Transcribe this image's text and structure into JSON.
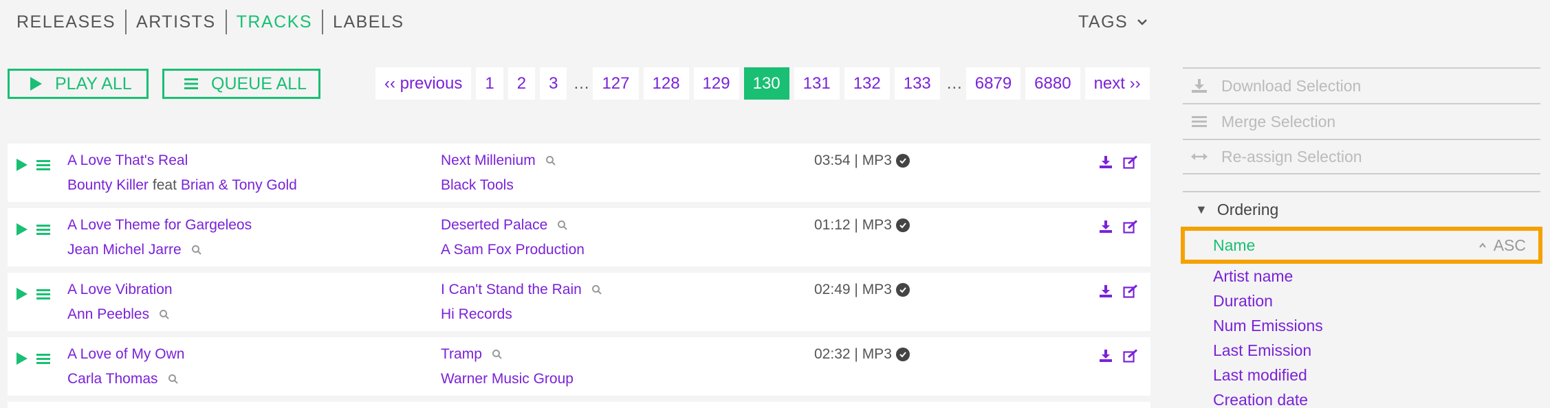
{
  "nav": {
    "items": [
      "RELEASES",
      "ARTISTS",
      "TRACKS",
      "LABELS"
    ],
    "active": "TRACKS",
    "tags_label": "TAGS"
  },
  "actions": {
    "play_all": "PLAY ALL",
    "queue_all": "QUEUE ALL"
  },
  "pagination": {
    "previous": "‹‹ previous",
    "next": "next ››",
    "pages": [
      "1",
      "2",
      "3",
      "…",
      "127",
      "128",
      "129",
      "130",
      "131",
      "132",
      "133",
      "…",
      "6879",
      "6880"
    ],
    "current": "130"
  },
  "tracks": [
    {
      "title": "A Love That's Real",
      "artist": "Bounty Killer",
      "feat_word": "feat",
      "feat_artist": "Brian & Tony Gold",
      "release": "Next Millenium",
      "label": "Black Tools",
      "duration": "03:54",
      "format": "MP3"
    },
    {
      "title": "A Love Theme for Gargeleos",
      "artist": "Jean Michel Jarre",
      "feat_word": "",
      "feat_artist": "",
      "release": "Deserted Palace",
      "label": "A Sam Fox Production",
      "duration": "01:12",
      "format": "MP3"
    },
    {
      "title": "A Love Vibration",
      "artist": "Ann Peebles",
      "feat_word": "",
      "feat_artist": "",
      "release": "I Can't Stand the Rain",
      "label": "Hi Records",
      "duration": "02:49",
      "format": "MP3"
    },
    {
      "title": "A Love of My Own",
      "artist": "Carla Thomas",
      "feat_word": "",
      "feat_artist": "",
      "release": "Tramp",
      "label": "Warner Music Group",
      "duration": "02:32",
      "format": "MP3"
    }
  ],
  "selection_actions": {
    "download": "Download Selection",
    "merge": "Merge Selection",
    "reassign": "Re-assign Selection"
  },
  "ordering": {
    "title": "Ordering",
    "active": "Name",
    "direction": "ASC",
    "items": [
      "Artist name",
      "Duration",
      "Num Emissions",
      "Last Emission",
      "Last modified",
      "Creation date"
    ]
  },
  "colors": {
    "accent_green": "#19bf73",
    "link_purple": "#7a22d8",
    "highlight_orange": "#f5a100"
  }
}
